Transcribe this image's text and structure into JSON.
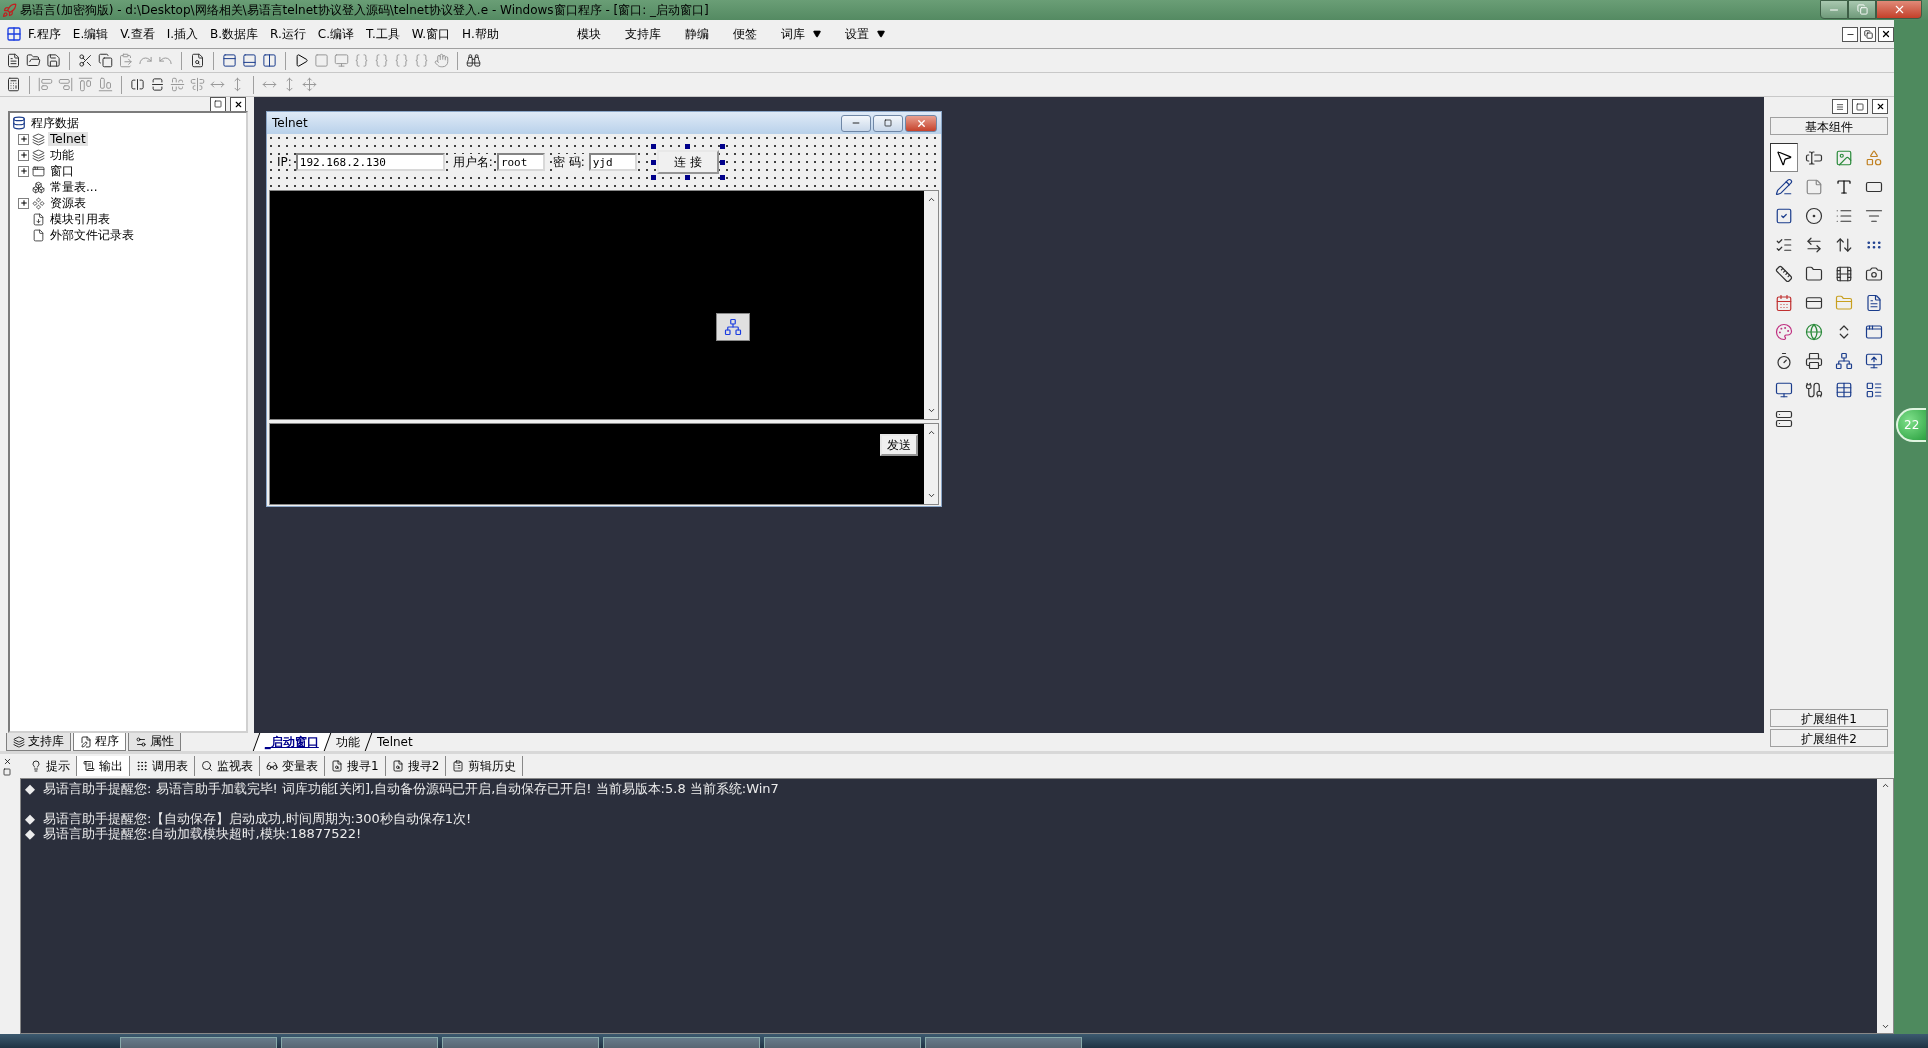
{
  "window": {
    "title": "易语言(加密狗版) - d:\\Desktop\\网络相关\\易语言telnet协议登入源码\\telnet协议登入.e - Windows窗口程序 - [窗口: _启动窗口]"
  },
  "menu": {
    "items": [
      {
        "label": "F.程序"
      },
      {
        "label": "E.编辑"
      },
      {
        "label": "V.查看"
      },
      {
        "label": "I.插入"
      },
      {
        "label": "B.数据库"
      },
      {
        "label": "R.运行"
      },
      {
        "label": "C.编译"
      },
      {
        "label": "T.工具"
      },
      {
        "label": "W.窗口"
      },
      {
        "label": "H.帮助"
      }
    ],
    "right_items": [
      {
        "label": "模块",
        "dropdown": false
      },
      {
        "label": "支持库",
        "dropdown": false
      },
      {
        "label": "静编",
        "dropdown": false
      },
      {
        "label": "便签",
        "dropdown": false
      },
      {
        "label": "词库",
        "dropdown": true
      },
      {
        "label": "设置",
        "dropdown": true
      }
    ]
  },
  "project_tree": {
    "root": "程序数据",
    "items": [
      {
        "label": "Telnet",
        "expandable": true,
        "selected": true
      },
      {
        "label": "功能",
        "expandable": true,
        "selected": false
      },
      {
        "label": "窗口",
        "expandable": true,
        "selected": false
      },
      {
        "label": "常量表...",
        "expandable": false,
        "selected": false
      },
      {
        "label": "资源表",
        "expandable": true,
        "selected": false
      },
      {
        "label": "模块引用表",
        "expandable": false,
        "selected": false
      },
      {
        "label": "外部文件记录表",
        "expandable": false,
        "selected": false
      }
    ]
  },
  "left_tabs": [
    {
      "label": "支持库",
      "selected": false
    },
    {
      "label": "程序",
      "selected": true
    },
    {
      "label": "属性",
      "selected": false
    }
  ],
  "form": {
    "title": "Telnet",
    "ip_label": "IP:",
    "ip": "192.168.2.130",
    "user_label": "用户名:",
    "user": "root",
    "pass_label": "密 码:",
    "password": "yjd",
    "connect_button": "连 接",
    "connect_selected": true,
    "send_button": "发送"
  },
  "doc_tabs": [
    {
      "label": "_启动窗口",
      "selected": true
    },
    {
      "label": "功能",
      "selected": false
    },
    {
      "label": "Telnet",
      "selected": false
    }
  ],
  "toolbox": {
    "title": "基本组件",
    "footer": [
      "扩展组件1",
      "扩展组件2"
    ]
  },
  "bottom_tabs": [
    {
      "label": "提示",
      "selected": false
    },
    {
      "label": "输出",
      "selected": true
    },
    {
      "label": "调用表",
      "selected": false
    },
    {
      "label": "监视表",
      "selected": false
    },
    {
      "label": "变量表",
      "selected": false
    },
    {
      "label": "搜寻1",
      "selected": false
    },
    {
      "label": "搜寻2",
      "selected": false
    },
    {
      "label": "剪辑历史",
      "selected": false
    }
  ],
  "output": {
    "blocks": [
      {
        "lines": [
          {
            "bullet": "◆",
            "text": "易语言助手提醒您:  易语言助手加载完毕! 词库功能[关闭],自动备份源码已开启,自动保存已开启! 当前易版本:5.8  当前系统:Win7"
          }
        ]
      },
      {
        "lines": [
          {
            "bullet": "◆",
            "text": "易语言助手提醒您:【自动保存】启动成功,时间周期为:300秒自动保存1次!"
          },
          {
            "bullet": "◆",
            "text": "易语言助手提醒您:自动加载模块超时,模块:18877522!"
          }
        ]
      }
    ]
  },
  "desktop_badge": "22"
}
